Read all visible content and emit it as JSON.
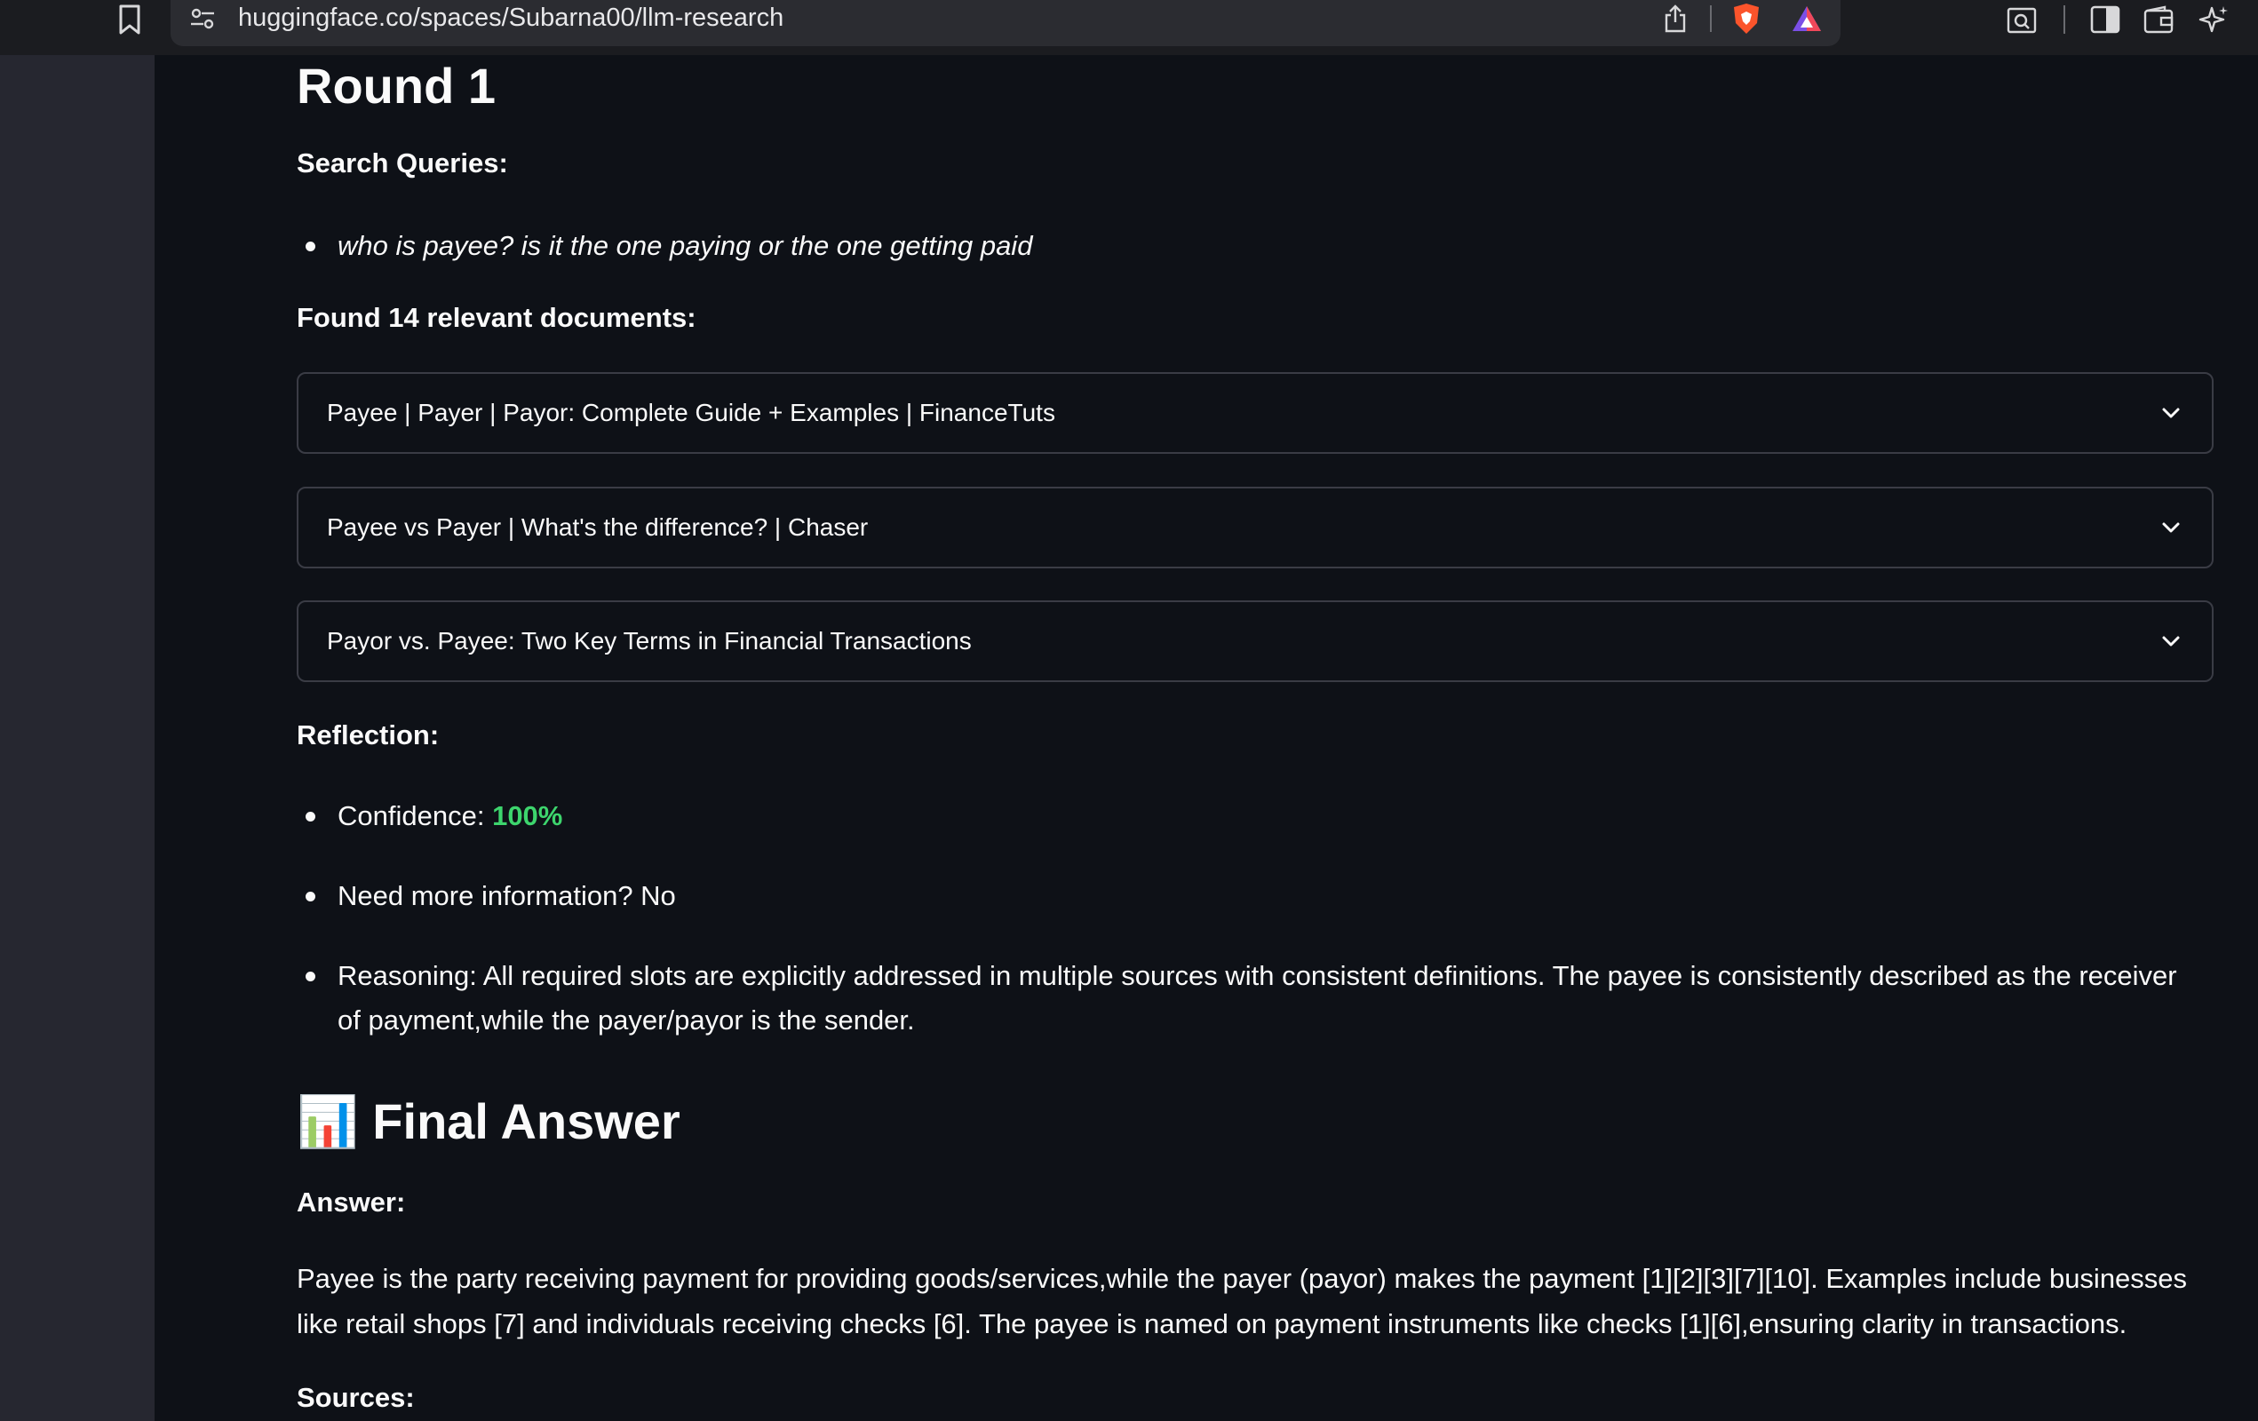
{
  "browser": {
    "url": "huggingface.co/spaces/Subarna00/llm-research"
  },
  "round": {
    "title": "Round 1",
    "search_queries_label": "Search Queries:",
    "queries": [
      "who is payee? is it the one paying or the one getting paid"
    ],
    "found_label": "Found 14 relevant documents:",
    "documents": [
      "Payee | Payer | Payor: Complete Guide + Examples | FinanceTuts",
      "Payee vs Payer | What's the difference? | Chaser",
      "Payor vs. Payee: Two Key Terms in Financial Transactions"
    ],
    "reflection_label": "Reflection:",
    "confidence_label": "Confidence:",
    "confidence_value": "100%",
    "need_more": "Need more information? No",
    "reasoning": "Reasoning: All required slots are explicitly addressed in multiple sources with consistent definitions. The payee is consistently described as the receiver of payment,while the payer/payor is the sender."
  },
  "final": {
    "emoji": "📊",
    "title": "Final Answer",
    "answer_label": "Answer:",
    "answer": "Payee is the party receiving payment for providing goods/services,while the payer (payor) makes the payment [1][2][3][7][10]. Examples include businesses like retail shops [7] and individuals receiving checks [6]. The payee is named on payment instruments like checks [1][6],ensuring clarity in transactions.",
    "sources_label": "Sources:"
  },
  "colors": {
    "confidence": "#3dd56d",
    "background": "#0e1117",
    "sidebar": "#262730"
  }
}
